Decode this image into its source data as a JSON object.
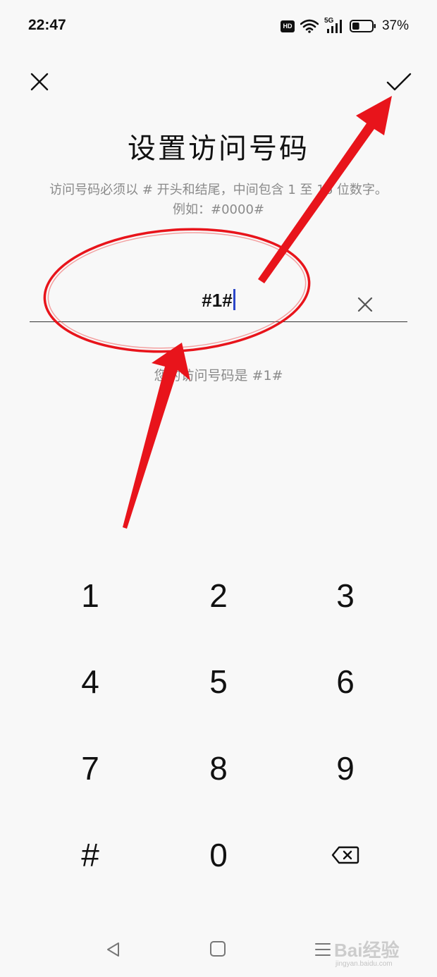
{
  "status_bar": {
    "time": "22:47",
    "hd_label": "HD",
    "network_label": "5G",
    "battery_percent": "37%",
    "battery_level": 0.37,
    "icons": [
      "hd-icon",
      "wifi-icon",
      "signal-5g-icon",
      "battery-icon"
    ]
  },
  "header": {
    "close_icon": "close-icon",
    "confirm_icon": "checkmark-icon",
    "title": "设置访问号码",
    "description_line1": "访问号码必须以 # 开头和结尾，中间包含 1 至 16 位数字。",
    "description_line2": "例如：#0000#"
  },
  "input": {
    "value": "#1#",
    "clear_icon": "clear-icon"
  },
  "hint": "您的访问号码是 #1#",
  "keypad": {
    "row1": [
      "1",
      "2",
      "3"
    ],
    "row2": [
      "4",
      "5",
      "6"
    ],
    "row3": [
      "7",
      "8",
      "9"
    ],
    "row4": [
      "#",
      "0"
    ],
    "backspace_icon": "backspace-icon"
  },
  "nav_bar": {
    "icons": [
      "back-triangle-icon",
      "home-square-icon",
      "menu-lines-icon"
    ]
  },
  "watermark": {
    "text": "Bai经验",
    "sub": "jingyan.baidu.com"
  },
  "colors": {
    "background": "#f8f8f8",
    "caret": "#2b46c8",
    "annotation_red": "#e8141b",
    "muted_text": "#8a8a8a"
  }
}
